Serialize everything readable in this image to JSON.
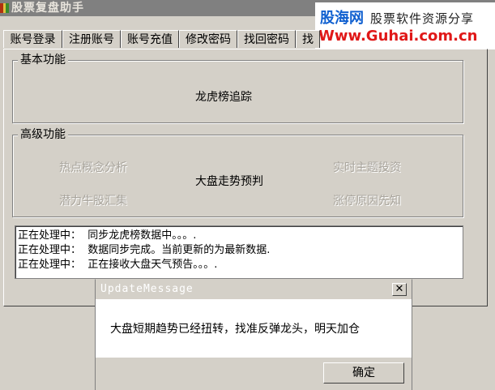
{
  "window": {
    "title": "股票复盘助手"
  },
  "watermark": {
    "brand": "股海网",
    "subtitle": "股票软件资源分享",
    "url": "Www.Guhai.com.cn"
  },
  "tabs": [
    {
      "label": "账号登录"
    },
    {
      "label": "注册账号"
    },
    {
      "label": "账号充值"
    },
    {
      "label": "修改密码"
    },
    {
      "label": "找回密码"
    },
    {
      "label": "找"
    }
  ],
  "basic_group": {
    "title": "基本功能",
    "items": [
      {
        "label": "龙虎榜追踪"
      }
    ]
  },
  "advanced_group": {
    "title": "高级功能",
    "items": [
      {
        "label": "热点概念分析",
        "enabled": false
      },
      {
        "label": "实时主题投资",
        "enabled": false
      },
      {
        "label": "大盘走势预判",
        "enabled": true
      },
      {
        "label": "潜力牛股汇集",
        "enabled": false
      },
      {
        "label": "涨停原因先知",
        "enabled": false
      }
    ]
  },
  "log": {
    "lines": [
      "正在处理中：  同步龙虎榜数据中。。。.",
      "正在处理中：  数据同步完成。当前更新的为最新数据.",
      "正在处理中：  正在接收大盘天气预告。。。."
    ]
  },
  "dialog": {
    "title": "UpdateMessage",
    "message": "大盘短期趋势已经扭转，找准反弹龙头，明天加仓",
    "ok_label": "确定",
    "close_glyph": "✕"
  }
}
